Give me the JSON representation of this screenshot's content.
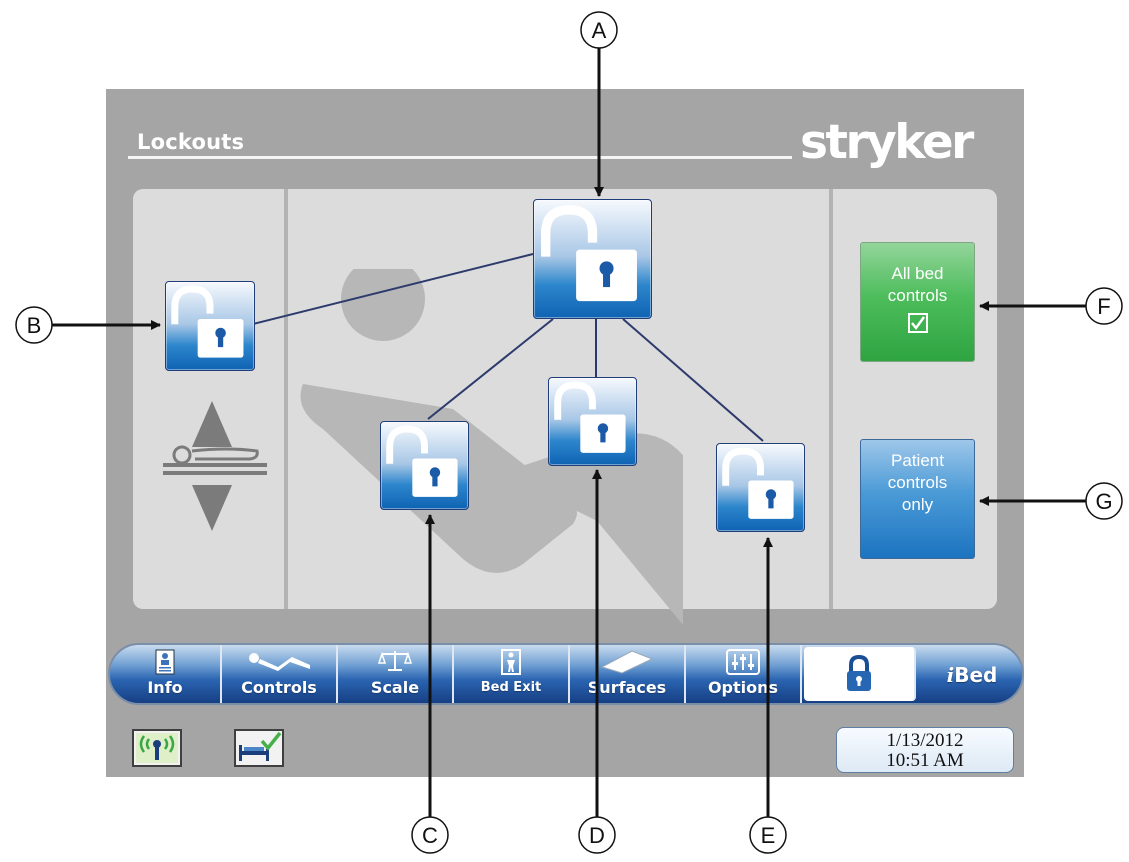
{
  "screen": {
    "title": "Lockouts",
    "brand": "stryker"
  },
  "mode_buttons": {
    "all_bed_controls": "All bed controls",
    "all_bed_controls_checked": true,
    "patient_controls_only": "Patient controls only"
  },
  "tabs": [
    {
      "label": "Info",
      "icon": "info-icon"
    },
    {
      "label": "Controls",
      "icon": "controls-icon"
    },
    {
      "label": "Scale",
      "icon": "scale-icon"
    },
    {
      "label": "Bed Exit",
      "icon": "bed-exit-icon"
    },
    {
      "label": "Surfaces",
      "icon": "surfaces-icon"
    },
    {
      "label": "Options",
      "icon": "options-icon"
    },
    {
      "label": "",
      "icon": "lock-icon",
      "active": true
    },
    {
      "label": "iBed",
      "icon": "ibed-icon"
    }
  ],
  "status": {
    "date": "1/13/2012",
    "time": "10:51 AM",
    "icons": [
      "wireless-icon",
      "bed-check-icon"
    ]
  },
  "callouts": [
    "A",
    "B",
    "C",
    "D",
    "E",
    "F",
    "G"
  ],
  "colors": {
    "screen_bg": "#a5a5a5",
    "panel_bg": "#dcdcdc",
    "lock_blue": "#1f75c4",
    "green": "#4ebd5c",
    "tab_blue": "#2b64b1"
  }
}
